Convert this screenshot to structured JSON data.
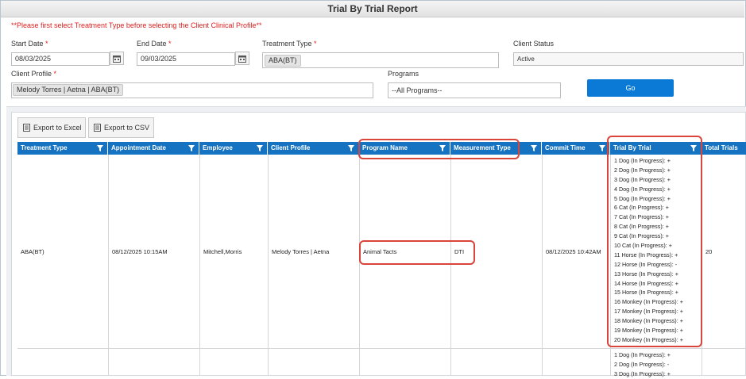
{
  "title": "Trial By Trial Report",
  "warning": "**Please first select Treatment Type before selecting the Client Clinical Profile**",
  "filters": {
    "start_date": {
      "label": "Start Date",
      "req": "*",
      "value": "08/03/2025"
    },
    "end_date": {
      "label": "End Date",
      "req": "*",
      "value": "09/03/2025"
    },
    "treatment_type": {
      "label": "Treatment Type",
      "req": "*",
      "chip": "ABA(BT)"
    },
    "client_status": {
      "label": "Client Status",
      "value": "Active"
    },
    "client_profile": {
      "label": "Client Profile",
      "req": "*",
      "chip": "Melody Torres | Aetna | ABA(BT)"
    },
    "programs": {
      "label": "Programs",
      "value": "--All Programs--"
    },
    "go_label": "Go"
  },
  "toolbar": {
    "export_excel": "Export to Excel",
    "export_csv": "Export to CSV"
  },
  "columns": [
    "Treatment Type",
    "Appointment Date",
    "Employee",
    "Client Profile",
    "Program Name",
    "Measurement Type",
    "Commit Time",
    "Trial By Trial",
    "Total Trials"
  ],
  "row1": {
    "treatment_type": "ABA(BT)",
    "appointment_date": "08/12/2025 10:15AM",
    "employee": "Mitchell,Morris",
    "client_profile": "Melody Torres | Aetna",
    "program_name": "Animal Tacts",
    "measurement_type": "DTI",
    "commit_time": "08/12/2025 10:42AM",
    "total_trials": "20",
    "trials": [
      "1 Dog (In Progress): +",
      "2 Dog (In Progress): +",
      "3 Dog (In Progress): +",
      "4 Dog (In Progress): +",
      "5 Dog (In Progress): +",
      "6 Cat (In Progress): +",
      "7 Cat (In Progress): +",
      "8 Cat (In Progress): +",
      "9 Cat (In Progress): +",
      "10 Cat (In Progress): +",
      "11 Horse (In Progress): +",
      "12 Horse (In Progress): -",
      "13 Horse (In Progress): +",
      "14 Horse (In Progress): +",
      "15 Horse (In Progress): +",
      "16 Monkey (In Progress): +",
      "17 Monkey (In Progress): +",
      "18 Monkey (In Progress): +",
      "19 Monkey (In Progress): +",
      "20 Monkey (In Progress): +"
    ]
  },
  "row2": {
    "trials": [
      "1 Dog (In Progress): +",
      "2 Dog (In Progress): -",
      "3 Dog (In Progress): +"
    ]
  },
  "icons": {
    "calendar": "calendar-icon",
    "filter": "filter-icon",
    "export": "export-icon"
  },
  "colors": {
    "header_bg": "#1673c2",
    "go_button": "#0a7ad6",
    "warning": "#e02020",
    "highlight": "#d9443b"
  }
}
